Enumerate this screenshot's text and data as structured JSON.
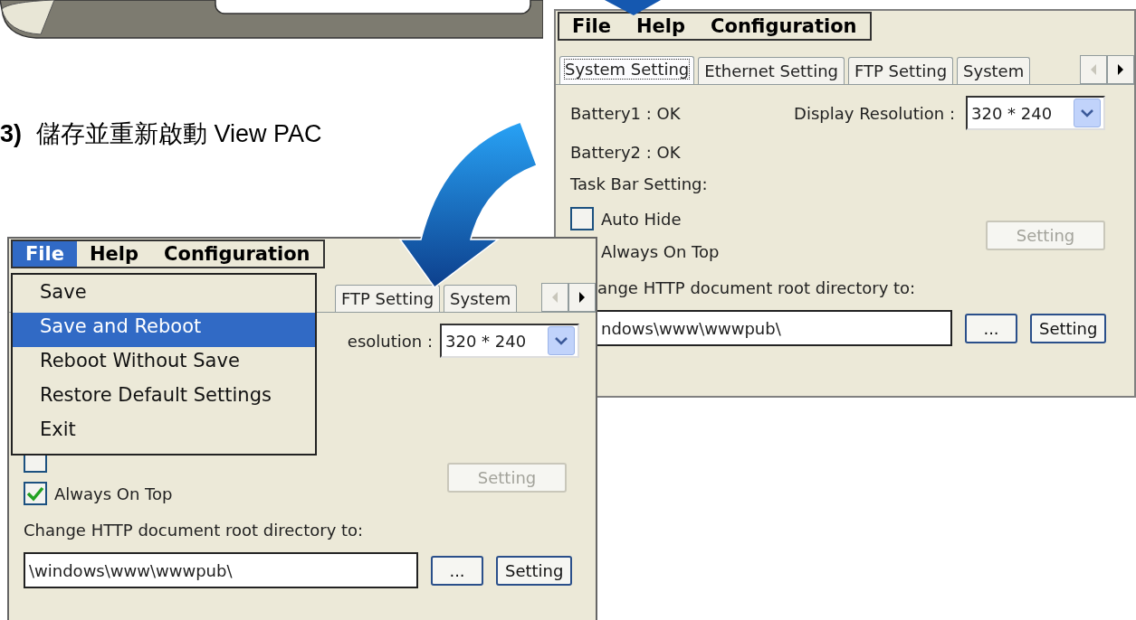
{
  "step": {
    "number": "3)",
    "text": "儲存並重新啟動 View PAC"
  },
  "back_window": {
    "menu": [
      {
        "label": "File",
        "selected": false
      },
      {
        "label": "Help",
        "selected": false
      },
      {
        "label": "Configuration",
        "selected": false
      }
    ],
    "tabs": [
      {
        "label": "System Setting",
        "selected": true
      },
      {
        "label": "Ethernet Setting",
        "selected": false
      },
      {
        "label": "FTP Setting",
        "selected": false
      },
      {
        "label": "System",
        "selected": false
      }
    ],
    "status_lines": [
      "Battery1 : OK",
      "Battery2 : OK"
    ],
    "resolution_label": "Display Resolution :",
    "resolution_value": "320 * 240",
    "taskbar_label": "Task Bar Setting:",
    "taskbar_options": [
      {
        "label": "Auto Hide",
        "checked": false
      },
      {
        "label": "Always On Top"
      }
    ],
    "taskbar_button": {
      "label": "Setting",
      "disabled": true
    },
    "http_label": "ange HTTP document root directory to:",
    "http_path": "ndows\\www\\wwwpub\\",
    "browse_button": "...",
    "apply_button": "Setting"
  },
  "front_window": {
    "menu": [
      {
        "label": "File",
        "selected": true
      },
      {
        "label": "Help",
        "selected": false
      },
      {
        "label": "Configuration",
        "selected": false
      }
    ],
    "tabs": [
      {
        "label": "FTP Setting",
        "selected": false
      },
      {
        "label": "System",
        "selected": false
      }
    ],
    "resolution_label": "esolution :",
    "resolution_value": "320 * 240",
    "taskbar_options": [
      {
        "checked": false
      },
      {
        "label": "Always On Top",
        "checked": true
      }
    ],
    "taskbar_button": {
      "label": "Setting",
      "disabled": true
    },
    "http_label": "Change HTTP document root directory to:",
    "http_path": "\\windows\\www\\wwwpub\\",
    "browse_button": "...",
    "apply_button": "Setting",
    "file_menu": [
      {
        "label": "Save",
        "selected": false
      },
      {
        "label": "Save and Reboot",
        "selected": true
      },
      {
        "label": "Reboot Without Save",
        "selected": false
      },
      {
        "label": "Restore Default Settings",
        "selected": false
      },
      {
        "label": "Exit",
        "selected": false
      }
    ]
  }
}
